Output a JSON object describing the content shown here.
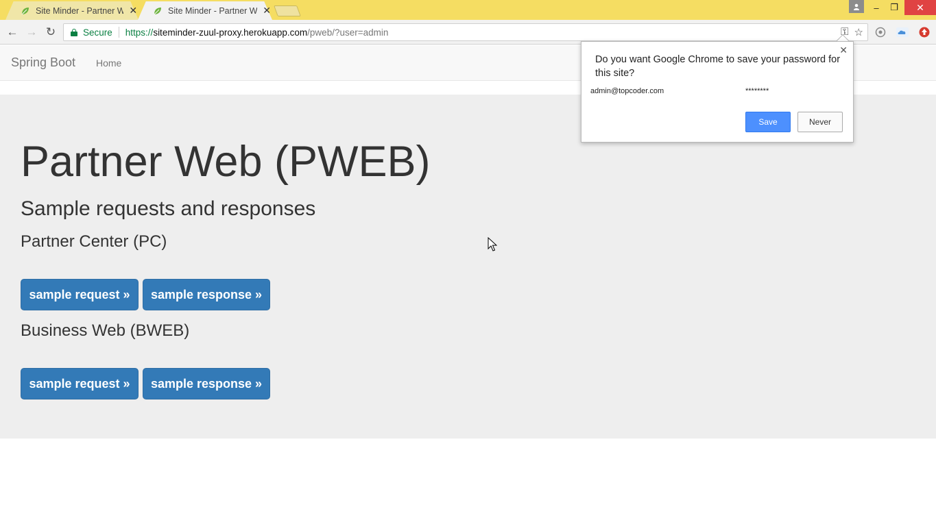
{
  "browser": {
    "tabs": [
      {
        "title": "Site Minder - Partner We",
        "close": "✕",
        "active": false
      },
      {
        "title": "Site Minder - Partner We",
        "close": "✕",
        "active": true
      }
    ],
    "window_controls": {
      "minimize": "–",
      "restore": "❐",
      "close": "✕"
    },
    "toolbar": {
      "back": "←",
      "forward": "→",
      "reload": "↻",
      "secure_label": "Secure",
      "url_scheme": "https://",
      "url_host": "siteminder-zuul-proxy.herokuapp.com",
      "url_path": "/pweb/?user=admin",
      "key_icon": "⚿",
      "star_icon": "☆"
    }
  },
  "page": {
    "navbar": {
      "brand": "Spring Boot",
      "home": "Home"
    },
    "jumbotron": {
      "title": "Partner Web (PWEB)",
      "subtitle": "Sample requests and responses",
      "sections": [
        {
          "heading": "Partner Center (PC)",
          "request_label": "sample request »",
          "response_label": "sample response »"
        },
        {
          "heading": "Business Web (BWEB)",
          "request_label": "sample request »",
          "response_label": "sample response »"
        }
      ]
    }
  },
  "password_bubble": {
    "question": "Do you want Google Chrome to save your password for this site?",
    "close": "✕",
    "username": "admin@topcoder.com",
    "password_mask": "********",
    "save_label": "Save",
    "never_label": "Never"
  },
  "colors": {
    "titlebar": "#f5dd62",
    "primary_button": "#337ab7",
    "jumbotron_bg": "#eeeeee",
    "save_button": "#4d90fe"
  }
}
